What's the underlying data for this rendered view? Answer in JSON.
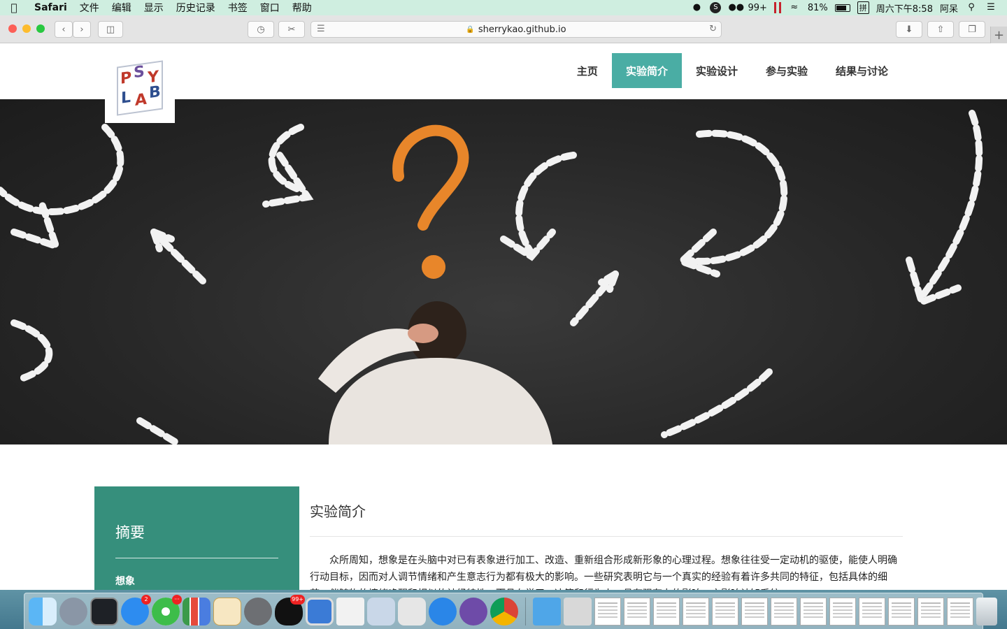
{
  "menubar": {
    "apple_icon": "apple-icon",
    "app_name": "Safari",
    "items": [
      "文件",
      "编辑",
      "显示",
      "历史记录",
      "书签",
      "窗口",
      "帮助"
    ],
    "wechat_badge": "99+",
    "battery_percent": "81%",
    "input_method": "拼",
    "clock": "周六下午8:58",
    "user": "阿呆"
  },
  "browser": {
    "url": "sherrykao.github.io"
  },
  "site": {
    "nav": [
      "主页",
      "实验简介",
      "实验设计",
      "参与实验",
      "结果与讨论"
    ],
    "active_nav": "实验简介",
    "logo_letters": [
      "P",
      "S",
      "Y",
      "L",
      "A",
      "B"
    ]
  },
  "sidebar": {
    "title": "摘要",
    "link": "想象"
  },
  "main": {
    "title": "实验简介",
    "paragraph": "众所周知，想象是在头脑中对已有表象进行加工、改造、重新组合形成新形象的心理过程。想象往往受一定动机的驱使，能使人明确行动目标，因而对人调节情绪和产生意志行为都有极大的影响。一些研究表明它与一个真实的经验有着许多共同的特征，包括具体的细节、伴随物的情绪唤醒和相似的神经特性，而且在学习、决策和行为上，具有强有力的影响。它影响认知系统"
  },
  "dock": {
    "appstore_badge": "2",
    "wechat_badge": "···",
    "qq_badge": "99+"
  },
  "colors": {
    "accent": "#4aada4",
    "sidebar": "#368f7c",
    "menubar": "#cfeee0"
  }
}
